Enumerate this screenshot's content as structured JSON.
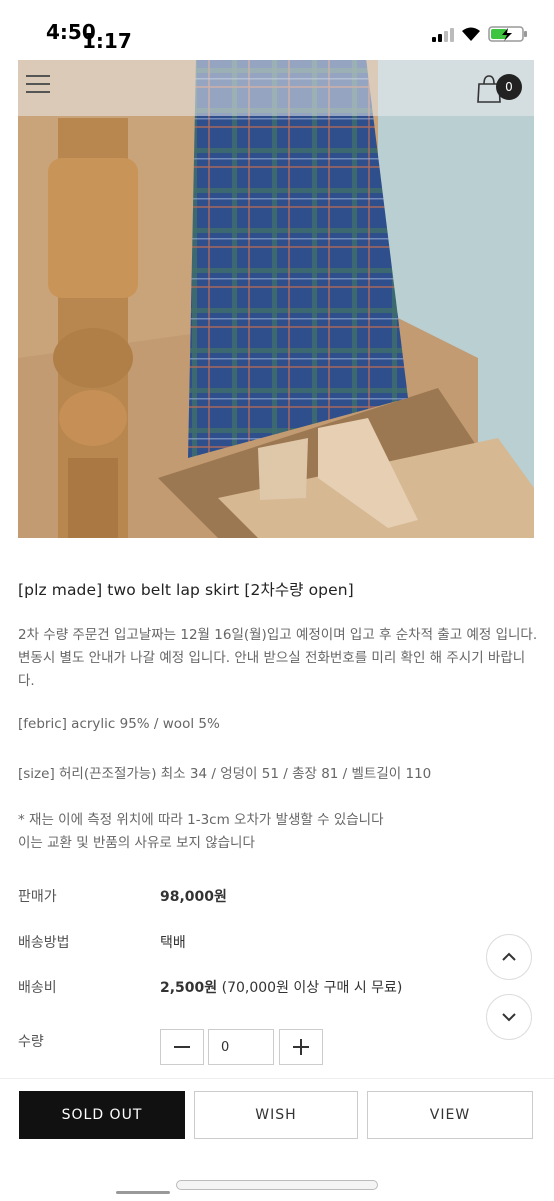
{
  "status_bar": {
    "time_a": "4:50",
    "time_b": "1:17"
  },
  "header": {
    "cart_count": "0",
    "menu_icon": "hamburger-icon",
    "cart_icon": "shopping-bag-icon"
  },
  "product": {
    "title": "[plz made] two belt lap skirt [2차수량 open]",
    "description": "2차 수량 주문건 입고날짜는 12월 16일(월)입고 예정이며 입고 후 순차적 출고 예정 입니다. 변동시 별도 안내가 나갈 예정 입니다. 안내 받으실 전화번호를 미리 확인 해 주시기 바랍니다.",
    "fabric": "[febric] acrylic 95% / wool 5%",
    "size": "[size] 허리(끈조절가능) 최소 34 / 엉덩이 51 / 총장 81 / 벨트길이 110",
    "note_1": "* 재는 이에 측정 위치에 따라 1-3cm 오차가 발생할 수 있습니다",
    "note_2": "이는 교환 및 반품의 사유로 보지 않습니다"
  },
  "info": {
    "price_label": "판매가",
    "price_value": "98,000원",
    "shipping_method_label": "배송방법",
    "shipping_method_value": "택배",
    "shipping_fee_label": "배송비",
    "shipping_fee_value": "2,500원",
    "shipping_fee_note": "(70,000원 이상 구매 시 무료)",
    "quantity_label": "수량",
    "quantity_value": "0"
  },
  "actions": {
    "sold_out": "SOLD OUT",
    "wish": "WISH",
    "view": "VIEW"
  },
  "colors": {
    "accent_dark": "#111111",
    "skirt_blue": "#2e4f8c"
  }
}
